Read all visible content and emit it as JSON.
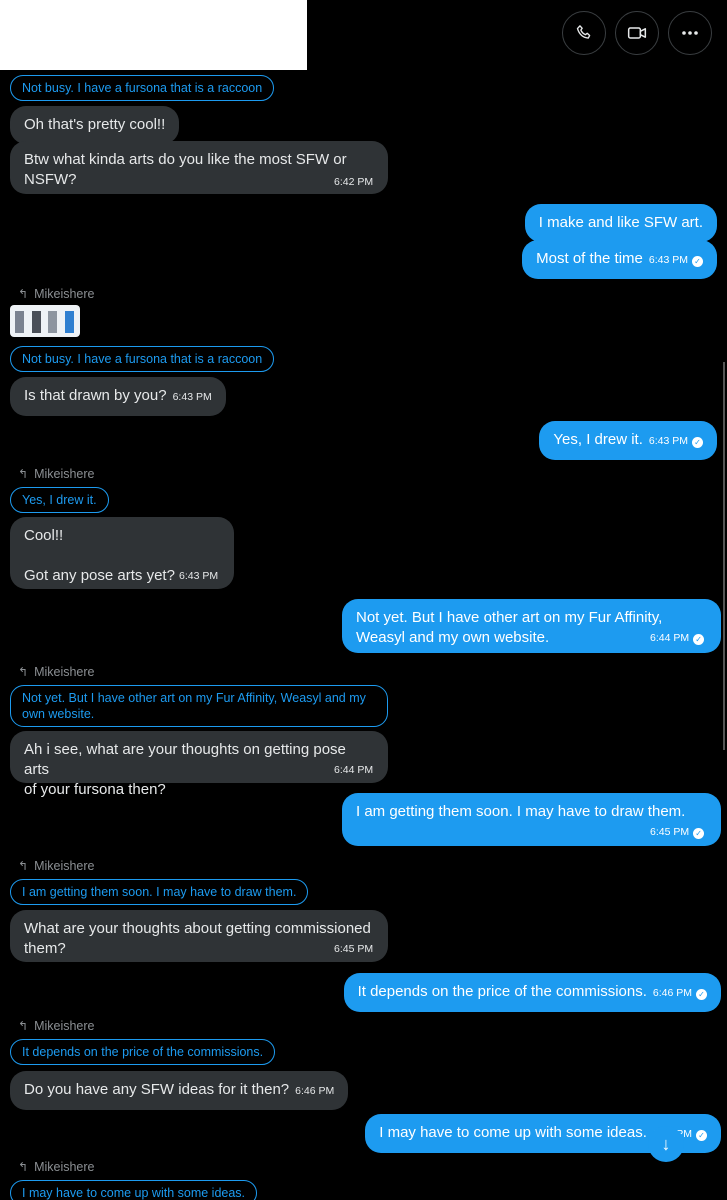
{
  "header": {
    "call_icon": "phone-icon",
    "video_icon": "video-icon",
    "more_icon": "more-icon"
  },
  "colors": {
    "accent": "#1d9bf0",
    "incoming": "#2f3336",
    "background": "#000000"
  },
  "reply_user": "Mikeishere",
  "messages": {
    "q1": "Not busy. I have a fursona that is a raccoon",
    "m1": "Oh that's pretty cool!!",
    "m2": "Btw what kinda arts do you like the most SFW or\nNSFW?",
    "t2": "6:42 PM",
    "m3": "I make and like SFW art.",
    "m4": "Most of the time",
    "t4": "6:43 PM",
    "q2": "Not busy. I have a fursona that is a raccoon",
    "m5": "Is that drawn by you?",
    "t5": "6:43 PM",
    "m6": "Yes, I drew it.",
    "t6": "6:43 PM",
    "q3": "Yes, I drew it.",
    "m7": "Cool!!\n\nGot any pose arts yet?",
    "t7": "6:43 PM",
    "m8": "Not yet. But I have other art on my Fur Affinity,\nWeasyl and my own website.",
    "t8": "6:44 PM",
    "q4": "Not yet. But I have other art on my Fur Affinity, Weasyl and my\nown website.",
    "m9": "Ah i see, what are your thoughts on getting pose arts\nof your fursona then?",
    "t9": "6:44 PM",
    "m10": "I am getting them soon. I may have to draw them.",
    "t10": "6:45 PM",
    "q5": "I am getting them soon. I may have to draw them.",
    "m11": "What are your thoughts about getting commissioned\nthem?",
    "t11": "6:45 PM",
    "m12": "It depends on the price of the commissions.",
    "t12": "6:46 PM",
    "q6": "It depends on the price of the commissions.",
    "m13": "Do you have any SFW ideas for it then?",
    "t13": "6:46 PM",
    "m14": "I may have to come up with some ideas.",
    "t14": "6:46 PM",
    "q7": "I may have to come up with some ideas."
  }
}
